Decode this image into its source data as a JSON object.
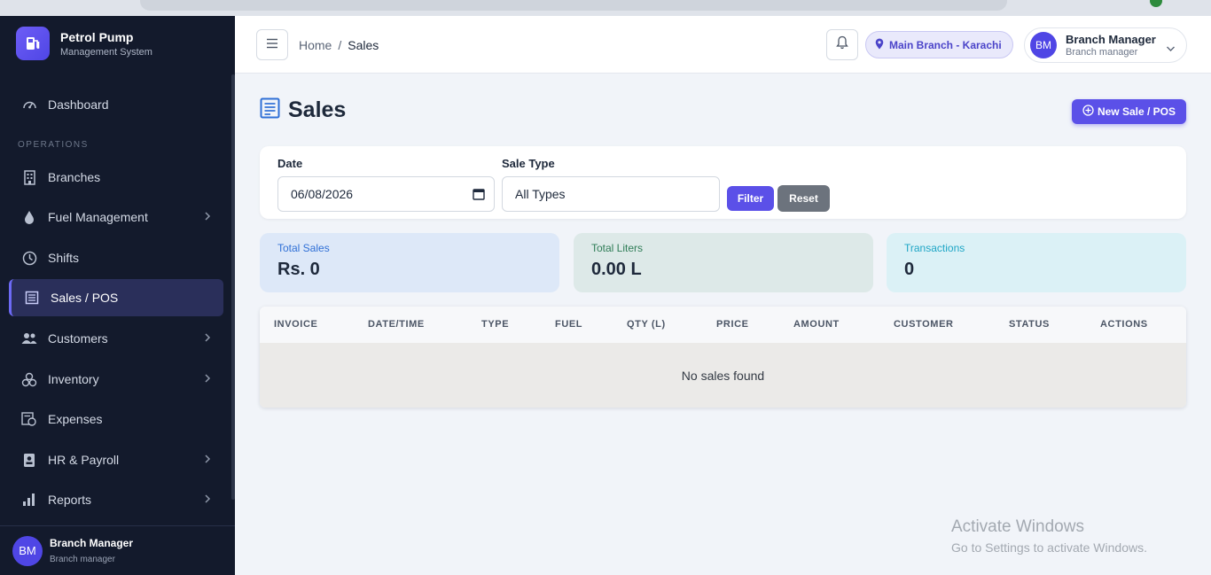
{
  "brand": {
    "title": "Petrol Pump",
    "subtitle": "Management System"
  },
  "sidebar": {
    "section_label": "OPERATIONS",
    "items": [
      {
        "label": "Dashboard",
        "icon": "gauge-icon"
      },
      {
        "label": "Branches",
        "icon": "building-icon"
      },
      {
        "label": "Fuel Management",
        "icon": "droplet-icon",
        "has_submenu": true
      },
      {
        "label": "Shifts",
        "icon": "clock-icon"
      },
      {
        "label": "Sales / POS",
        "icon": "receipt-icon",
        "active": true
      },
      {
        "label": "Customers",
        "icon": "users-icon",
        "has_submenu": true
      },
      {
        "label": "Inventory",
        "icon": "boxes-icon",
        "has_submenu": true
      },
      {
        "label": "Expenses",
        "icon": "cash-icon"
      },
      {
        "label": "HR & Payroll",
        "icon": "id-badge-icon",
        "has_submenu": true
      },
      {
        "label": "Reports",
        "icon": "bar-chart-icon",
        "has_submenu": true
      }
    ],
    "user": {
      "initials": "BM",
      "name": "Branch Manager",
      "role": "Branch manager"
    }
  },
  "topbar": {
    "breadcrumb": {
      "home": "Home",
      "separator": "/",
      "current": "Sales"
    },
    "branch": "Main Branch - Karachi",
    "user": {
      "initials": "BM",
      "name": "Branch Manager",
      "role": "Branch manager"
    }
  },
  "page": {
    "title": "Sales",
    "new_button": "New Sale / POS"
  },
  "filters": {
    "date_label": "Date",
    "date_value": "06/08/2026",
    "type_label": "Sale Type",
    "type_value": "All Types",
    "filter_button": "Filter",
    "reset_button": "Reset"
  },
  "stats": [
    {
      "label": "Total Sales",
      "value": "Rs. 0"
    },
    {
      "label": "Total Liters",
      "value": "0.00 L"
    },
    {
      "label": "Transactions",
      "value": "0"
    }
  ],
  "table": {
    "columns": [
      "INVOICE",
      "DATE/TIME",
      "TYPE",
      "FUEL",
      "QTY (L)",
      "PRICE",
      "AMOUNT",
      "CUSTOMER",
      "STATUS",
      "ACTIONS"
    ],
    "empty_text": "No sales found"
  },
  "watermark": {
    "line1": "Activate Windows",
    "line2": "Go to Settings to activate Windows."
  },
  "colors": {
    "accent": "#5b50e8",
    "sidebar_bg": "#131a2c",
    "page_bg": "#f1f4f9"
  }
}
